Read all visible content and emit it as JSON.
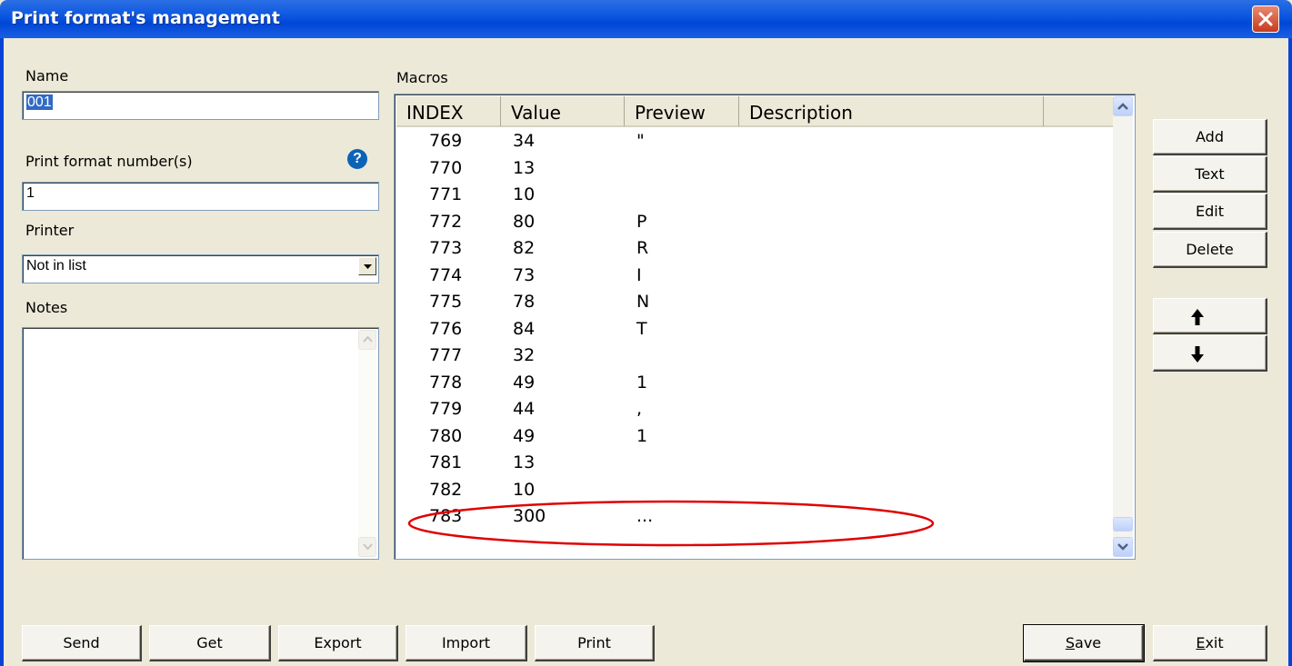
{
  "window": {
    "title": "Print format's management"
  },
  "left": {
    "name_label": "Name",
    "name_value": "001",
    "format_label": "Print format number(s)",
    "format_value": "1",
    "printer_label": "Printer",
    "printer_value": "Not in list",
    "notes_label": "Notes",
    "notes_value": ""
  },
  "macros": {
    "label": "Macros",
    "columns": [
      "INDEX",
      "Value",
      "Preview",
      "Description"
    ],
    "rows": [
      {
        "index": "769",
        "value": "34",
        "preview": "\""
      },
      {
        "index": "770",
        "value": "13",
        "preview": ""
      },
      {
        "index": "771",
        "value": "10",
        "preview": ""
      },
      {
        "index": "772",
        "value": "80",
        "preview": "P"
      },
      {
        "index": "773",
        "value": "82",
        "preview": "R"
      },
      {
        "index": "774",
        "value": "73",
        "preview": "I"
      },
      {
        "index": "775",
        "value": "78",
        "preview": "N"
      },
      {
        "index": "776",
        "value": "84",
        "preview": "T"
      },
      {
        "index": "777",
        "value": "32",
        "preview": ""
      },
      {
        "index": "778",
        "value": "49",
        "preview": "1"
      },
      {
        "index": "779",
        "value": "44",
        "preview": ","
      },
      {
        "index": "780",
        "value": "49",
        "preview": "1"
      },
      {
        "index": "781",
        "value": "13",
        "preview": ""
      },
      {
        "index": "782",
        "value": "10",
        "preview": ""
      },
      {
        "index": "783",
        "value": "300",
        "preview": "..."
      }
    ]
  },
  "side_buttons": {
    "add": "Add",
    "text": "Text",
    "edit": "Edit",
    "delete": "Delete"
  },
  "bottom_buttons": {
    "send": "Send",
    "get": "Get",
    "export": "Export",
    "import": "Import",
    "print": "Print",
    "save": "Save",
    "exit": "Exit"
  },
  "icons": {
    "help": "help-icon",
    "close": "close-icon",
    "up": "arrow-up-icon",
    "down": "arrow-down-icon"
  },
  "colors": {
    "titlebar": "#0a55e0",
    "selection": "#316ac5",
    "annotation": "#e00000"
  }
}
